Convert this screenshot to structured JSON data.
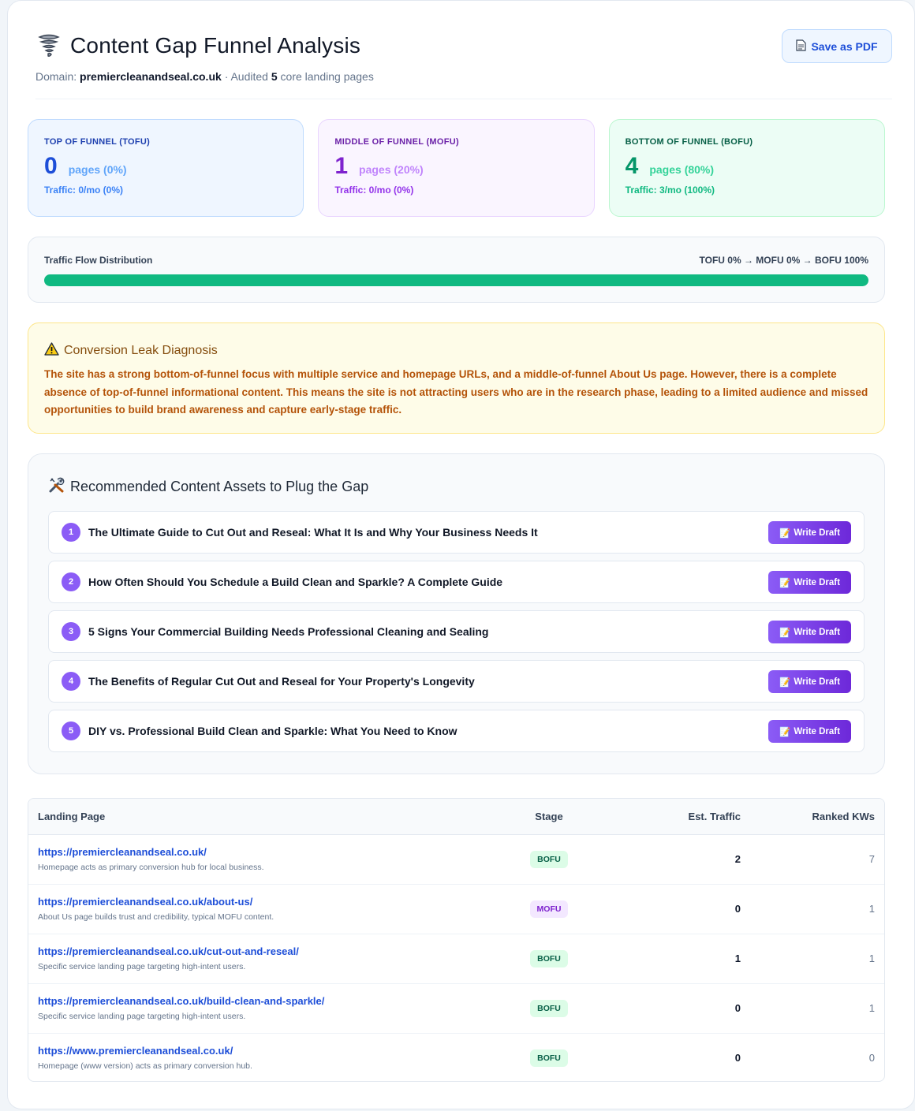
{
  "header": {
    "title": "Content Gap Funnel Analysis",
    "domain_label": "Domain:",
    "domain": "premiercleanandseal.co.uk",
    "audited_prefix": "· Audited",
    "audited_count": "5",
    "audited_suffix": "core landing pages",
    "save_label": "Save as PDF"
  },
  "stages": [
    {
      "label": "TOP OF FUNNEL (TOFU)",
      "count": "0",
      "pages": "pages (0%)",
      "traffic": "Traffic: 0/mo (0%)"
    },
    {
      "label": "MIDDLE OF FUNNEL (MOFU)",
      "count": "1",
      "pages": "pages (20%)",
      "traffic": "Traffic: 0/mo (0%)"
    },
    {
      "label": "BOTTOM OF FUNNEL (BOFU)",
      "count": "4",
      "pages": "pages (80%)",
      "traffic": "Traffic: 3/mo (100%)"
    }
  ],
  "flow": {
    "label": "Traffic Flow Distribution",
    "summary": "TOFU 0% → MOFU 0% → BOFU 100%",
    "segments": [
      {
        "stage": "TOFU",
        "percent": 0,
        "color": "#3b82f6"
      },
      {
        "stage": "MOFU",
        "percent": 0,
        "color": "#a855f7"
      },
      {
        "stage": "BOFU",
        "percent": 100,
        "color": "#10b981"
      }
    ]
  },
  "leak": {
    "title": "Conversion Leak Diagnosis",
    "text": "The site has a strong bottom-of-funnel focus with multiple service and homepage URLs, and a middle-of-funnel About Us page. However, there is a complete absence of top-of-funnel informational content. This means the site is not attracting users who are in the research phase, leading to a limited audience and missed opportunities to build brand awareness and capture early-stage traffic."
  },
  "recommendations": {
    "title": "Recommended Content Assets to Plug the Gap",
    "button_label": "Write Draft",
    "items": [
      {
        "num": "1",
        "text": "The Ultimate Guide to Cut Out and Reseal: What It Is and Why Your Business Needs It"
      },
      {
        "num": "2",
        "text": "How Often Should You Schedule a Build Clean and Sparkle? A Complete Guide"
      },
      {
        "num": "3",
        "text": "5 Signs Your Commercial Building Needs Professional Cleaning and Sealing"
      },
      {
        "num": "4",
        "text": "The Benefits of Regular Cut Out and Reseal for Your Property's Longevity"
      },
      {
        "num": "5",
        "text": "DIY vs. Professional Build Clean and Sparkle: What You Need to Know"
      }
    ]
  },
  "table": {
    "headers": {
      "page": "Landing Page",
      "stage": "Stage",
      "traffic": "Est. Traffic",
      "kws": "Ranked KWs"
    },
    "rows": [
      {
        "url": "https://premiercleanandseal.co.uk/",
        "note": "Homepage acts as primary conversion hub for local business.",
        "stage": "BOFU",
        "traffic": "2",
        "kws": "7"
      },
      {
        "url": "https://premiercleanandseal.co.uk/about-us/",
        "note": "About Us page builds trust and credibility, typical MOFU content.",
        "stage": "MOFU",
        "traffic": "0",
        "kws": "1"
      },
      {
        "url": "https://premiercleanandseal.co.uk/cut-out-and-reseal/",
        "note": "Specific service landing page targeting high-intent users.",
        "stage": "BOFU",
        "traffic": "1",
        "kws": "1"
      },
      {
        "url": "https://premiercleanandseal.co.uk/build-clean-and-sparkle/",
        "note": "Specific service landing page targeting high-intent users.",
        "stage": "BOFU",
        "traffic": "0",
        "kws": "1"
      },
      {
        "url": "https://www.premiercleanandseal.co.uk/",
        "note": "Homepage (www version) acts as primary conversion hub.",
        "stage": "BOFU",
        "traffic": "0",
        "kws": "0"
      }
    ]
  },
  "icons": {
    "title": "tornado-icon",
    "save": "document-icon",
    "leak": "warning-icon",
    "reco": "tools-icon",
    "draft": "memo-icon"
  }
}
